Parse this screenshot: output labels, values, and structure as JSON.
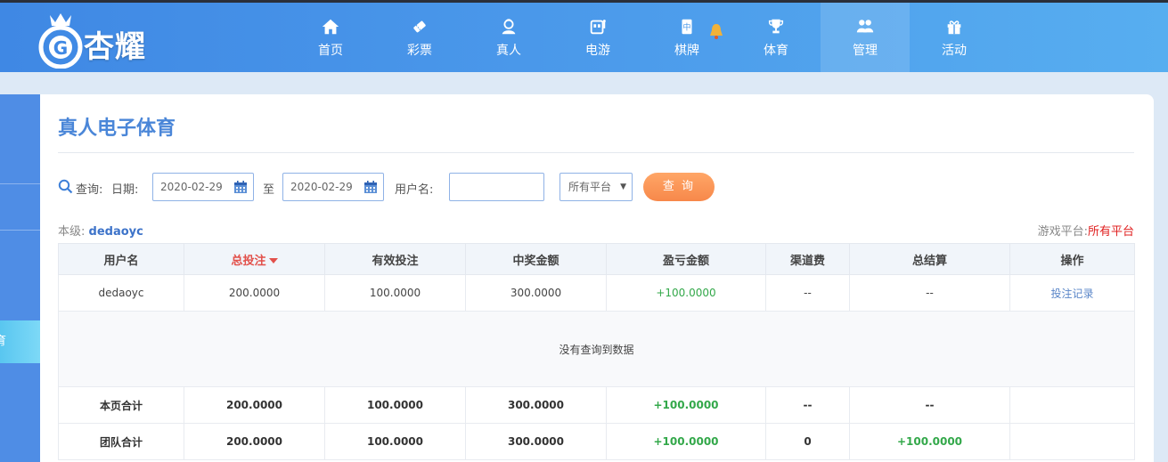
{
  "brand": {
    "logo_text": "杏耀"
  },
  "nav": {
    "items": [
      {
        "label": "首页",
        "icon": "home-icon"
      },
      {
        "label": "彩票",
        "icon": "lottery-ticket-icon"
      },
      {
        "label": "真人",
        "icon": "live-dealer-icon"
      },
      {
        "label": "电游",
        "icon": "slot-machine-icon"
      },
      {
        "label": "棋牌",
        "icon": "mahjong-tile-icon"
      },
      {
        "label": "体育",
        "icon": "trophy-icon"
      },
      {
        "label": "管理",
        "icon": "users-icon",
        "active": true
      },
      {
        "label": "活动",
        "icon": "gift-icon"
      }
    ]
  },
  "sidebar": {
    "active_label": "育"
  },
  "page": {
    "title": "真人电子体育"
  },
  "query": {
    "label": "查询:",
    "date_label": "日期:",
    "start_date": "2020-02-29",
    "to_label": "至",
    "end_date": "2020-02-29",
    "username_label": "用户名:",
    "username_value": "",
    "platform_select": "所有平台",
    "submit_label": "查 询"
  },
  "summary": {
    "level_label": "本级:",
    "level_user": "dedaoyc",
    "platform_label": "游戏平台:",
    "platform_value": "所有平台"
  },
  "table": {
    "columns": [
      "用户名",
      "总投注",
      "有效投注",
      "中奖金额",
      "盈亏金额",
      "渠道费",
      "总结算",
      "操作"
    ],
    "rows": [
      {
        "user": "dedaoyc",
        "total_bet": "200.0000",
        "valid_bet": "100.0000",
        "win": "300.0000",
        "profit": "+100.0000",
        "fee": "--",
        "settle": "--",
        "action": "投注记录"
      }
    ],
    "empty_text": "没有查询到数据",
    "page_total": {
      "label": "本页合计",
      "total_bet": "200.0000",
      "valid_bet": "100.0000",
      "win": "300.0000",
      "profit": "+100.0000",
      "fee": "--",
      "settle": "--"
    },
    "team_total": {
      "label": "团队合计",
      "total_bet": "200.0000",
      "valid_bet": "100.0000",
      "win": "300.0000",
      "profit": "+100.0000",
      "fee": "0",
      "settle": "+100.0000"
    }
  },
  "colors": {
    "accent": "#4a86d8",
    "profit": "#33a84a",
    "sort": "#e2504a",
    "button": "#f7884a"
  }
}
